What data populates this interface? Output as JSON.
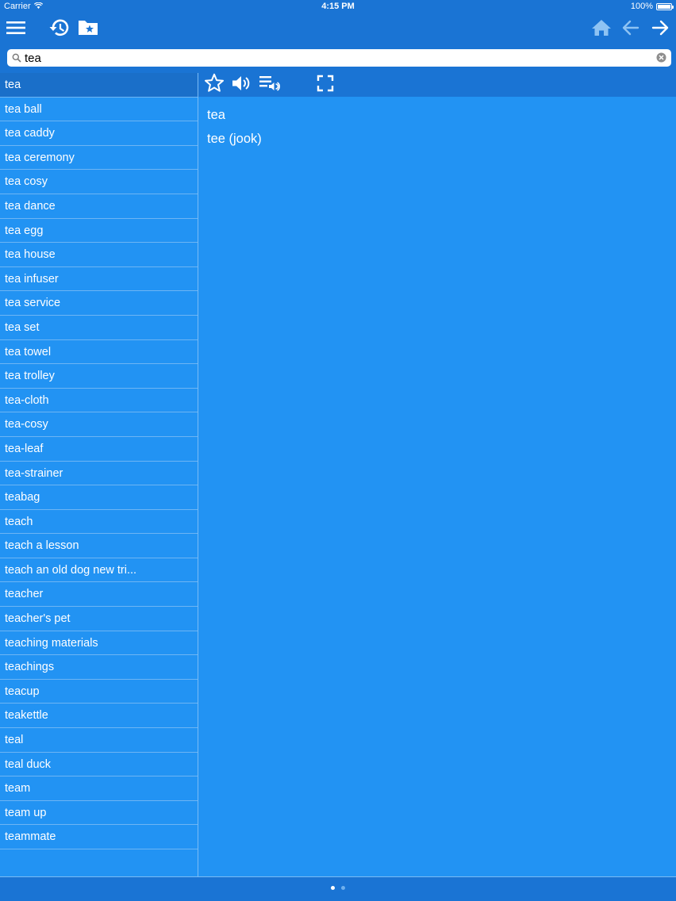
{
  "status": {
    "carrier": "Carrier",
    "time": "4:15 PM",
    "battery": "100%"
  },
  "toolbar": {
    "icons": [
      "menu-icon",
      "history-icon",
      "favorites-folder-icon",
      "home-icon",
      "back-arrow-icon",
      "forward-arrow-icon"
    ]
  },
  "search": {
    "value": "tea",
    "placeholder": ""
  },
  "word_list": {
    "selected_index": 0,
    "items": [
      "tea",
      "tea ball",
      "tea caddy",
      "tea ceremony",
      "tea cosy",
      "tea dance",
      "tea egg",
      "tea house",
      "tea infuser",
      "tea service",
      "tea set",
      "tea towel",
      "tea trolley",
      "tea-cloth",
      "tea-cosy",
      "tea-leaf",
      "tea-strainer",
      "teabag",
      "teach",
      "teach a lesson",
      "teach an old dog new tri...",
      "teacher",
      "teacher's pet",
      "teaching materials",
      "teachings",
      "teacup",
      "teakettle",
      "teal",
      "teal duck",
      "team",
      "team up",
      "teammate"
    ]
  },
  "detail_toolbar": {
    "icons": [
      "star-icon",
      "speaker-icon",
      "playlist-audio-icon",
      "fullscreen-icon"
    ]
  },
  "entry": {
    "headword": "tea",
    "translation": "tee (jook)"
  },
  "pager": {
    "pages": 2,
    "current": 0
  },
  "colors": {
    "bar": "#1a74d4",
    "background": "#2293f3",
    "selected_row": "#1a6fc9"
  }
}
